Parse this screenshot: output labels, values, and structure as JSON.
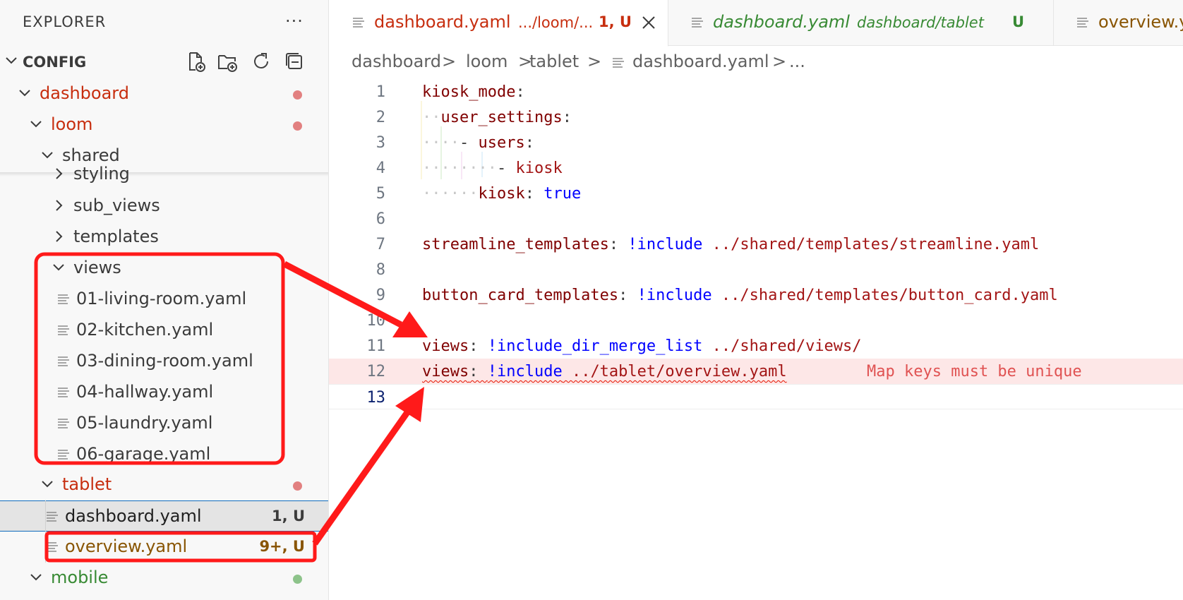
{
  "sidebar": {
    "title": "EXPLORER",
    "more": "···",
    "section": "CONFIG",
    "toolbar_icons": [
      "new-file-icon",
      "new-folder-icon",
      "refresh-icon",
      "collapse-all-icon"
    ],
    "tree": [
      {
        "label": "dashboard",
        "expanded": true,
        "color": "#c72e0f",
        "dot": "#e28080"
      },
      {
        "label": "loom",
        "expanded": true,
        "color": "#c72e0f",
        "dot": "#e28080"
      },
      {
        "label": "shared",
        "expanded": true,
        "color": "#3b3b3b"
      },
      {
        "label": "styling",
        "expanded": false,
        "color": "#3b3b3b"
      },
      {
        "label": "sub_views",
        "expanded": false,
        "color": "#3b3b3b"
      },
      {
        "label": "templates",
        "expanded": false,
        "color": "#3b3b3b"
      },
      {
        "label": "views",
        "expanded": true,
        "color": "#3b3b3b"
      },
      {
        "label": "01-living-room.yaml",
        "file": true,
        "color": "#3b3b3b"
      },
      {
        "label": "02-kitchen.yaml",
        "file": true,
        "color": "#3b3b3b"
      },
      {
        "label": "03-dining-room.yaml",
        "file": true,
        "color": "#3b3b3b"
      },
      {
        "label": "04-hallway.yaml",
        "file": true,
        "color": "#3b3b3b"
      },
      {
        "label": "05-laundry.yaml",
        "file": true,
        "color": "#3b3b3b"
      },
      {
        "label": "06-garage.yaml",
        "file": true,
        "color": "#3b3b3b"
      },
      {
        "label": "tablet",
        "expanded": true,
        "color": "#c72e0f",
        "dot": "#e28080"
      },
      {
        "label": "dashboard.yaml",
        "file": true,
        "color": "#1f1f1f",
        "badge": "1, U",
        "badge_color": "#3b3b3b"
      },
      {
        "label": "overview.yaml",
        "file": true,
        "color": "#895503",
        "badge": "9+, U",
        "badge_color": "#895503"
      },
      {
        "label": "mobile",
        "expanded": true,
        "color": "#388a34",
        "dot": "#8dc38a"
      }
    ]
  },
  "tabs": [
    {
      "name": "dashboard.yaml",
      "desc": ".../loom/...",
      "status": "1, U",
      "name_color": "#c72e0f",
      "status_color": "#c72e0f",
      "active": true
    },
    {
      "name": "dashboard.yaml",
      "desc": "dashboard/tablet",
      "status": "U",
      "name_color": "#388a34",
      "status_color": "#388a34",
      "active": false
    },
    {
      "name": "overview.y",
      "desc": "",
      "status": "",
      "name_color": "#895503",
      "status_color": "#895503",
      "active": false
    }
  ],
  "breadcrumb": [
    "dashboard",
    ">",
    "loom",
    ">",
    "tablet",
    ">",
    "dashboard.yaml",
    ">",
    "..."
  ],
  "editor": {
    "lines": [
      {
        "n": "1",
        "parts": [
          {
            "t": "kiosk_mode",
            "c": "k"
          },
          {
            "t": ":",
            "c": "p"
          }
        ]
      },
      {
        "n": "2",
        "parts": [
          {
            "t": "··",
            "c": "ws"
          },
          {
            "t": "user_settings",
            "c": "k"
          },
          {
            "t": ":",
            "c": "p"
          }
        ]
      },
      {
        "n": "3",
        "parts": [
          {
            "t": "····",
            "c": "ws"
          },
          {
            "t": "- ",
            "c": "p"
          },
          {
            "t": "users",
            "c": "k"
          },
          {
            "t": ":",
            "c": "p"
          }
        ]
      },
      {
        "n": "4",
        "parts": [
          {
            "t": "········",
            "c": "ws"
          },
          {
            "t": "- ",
            "c": "p"
          },
          {
            "t": "kiosk",
            "c": "s"
          }
        ]
      },
      {
        "n": "5",
        "parts": [
          {
            "t": "······",
            "c": "ws"
          },
          {
            "t": "kiosk",
            "c": "k"
          },
          {
            "t": ": ",
            "c": "p"
          },
          {
            "t": "true",
            "c": "b"
          }
        ]
      },
      {
        "n": "6",
        "parts": []
      },
      {
        "n": "7",
        "parts": [
          {
            "t": "streamline_templates",
            "c": "k"
          },
          {
            "t": ": ",
            "c": "p"
          },
          {
            "t": "!include",
            "c": "b"
          },
          {
            "t": " ../shared/templates/streamline.yaml",
            "c": "s"
          }
        ]
      },
      {
        "n": "8",
        "parts": []
      },
      {
        "n": "9",
        "parts": [
          {
            "t": "button_card_templates",
            "c": "k"
          },
          {
            "t": ": ",
            "c": "p"
          },
          {
            "t": "!include",
            "c": "b"
          },
          {
            "t": " ../shared/templates/button_card.yaml",
            "c": "s"
          }
        ]
      },
      {
        "n": "10",
        "parts": []
      },
      {
        "n": "11",
        "parts": [
          {
            "t": "views",
            "c": "k"
          },
          {
            "t": ": ",
            "c": "p"
          },
          {
            "t": "!include_dir_merge_list",
            "c": "b"
          },
          {
            "t": " ../shared/views/",
            "c": "s"
          }
        ]
      },
      {
        "n": "12",
        "parts": [
          {
            "t": "views",
            "c": "k"
          },
          {
            "t": ": ",
            "c": "p"
          },
          {
            "t": "!include",
            "c": "b"
          },
          {
            "t": " ../tablet/overview.yaml",
            "c": "s"
          }
        ],
        "error": true
      },
      {
        "n": "13",
        "parts": [],
        "current": true
      }
    ],
    "error_message": "Map keys must be unique"
  },
  "annotation_color": "#ff1a1a"
}
